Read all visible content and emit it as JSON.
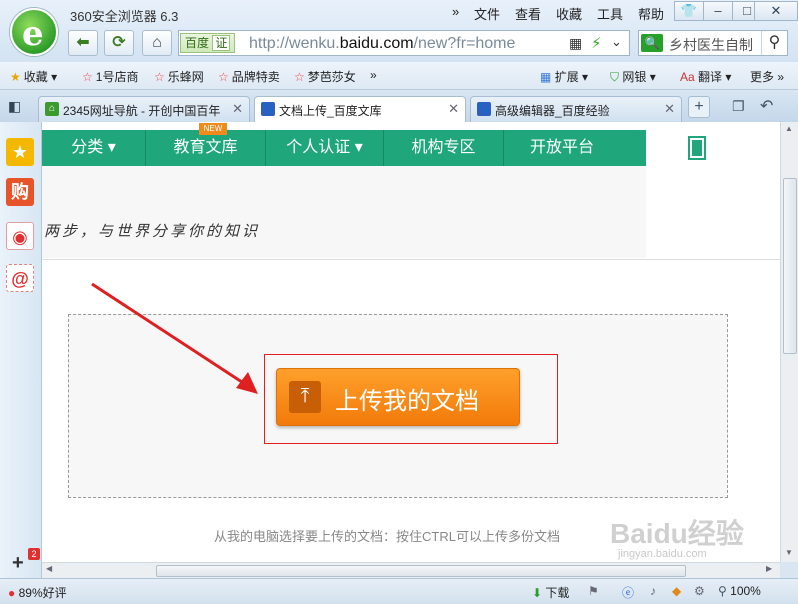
{
  "window": {
    "title": "360安全浏览器 6.3",
    "menu": [
      "文件",
      "查看",
      "收藏",
      "工具",
      "帮助"
    ],
    "chevron": "»"
  },
  "address": {
    "badge": "百度",
    "badge_tag": "证",
    "url_prefix": "http://wenku.",
    "url_domain": "baidu.com",
    "url_suffix": "/new?fr=home"
  },
  "search": {
    "query": "乡村医生自制"
  },
  "favorites": {
    "items": [
      "收藏",
      "1号店商",
      "乐蜂网",
      "品牌特卖",
      "梦芭莎女"
    ],
    "more_chevron": "»",
    "right": [
      "扩展",
      "网银",
      "翻译",
      "更多"
    ]
  },
  "tabs": [
    {
      "label": "2345网址导航 - 开创中国百年"
    },
    {
      "label": "文档上传_百度文库"
    },
    {
      "label": "高级编辑器_百度经验"
    }
  ],
  "sidebar": {
    "badge": "2"
  },
  "page": {
    "nav": [
      "分类",
      "教育文库",
      "个人认证",
      "机构专区",
      "开放平台"
    ],
    "new_badge": "NEW",
    "slogan": "两步，与世界分享你的知识",
    "upload_button": "上传我的文档",
    "hint": "从我的电脑选择要上传的文档：按住CTRL可以上传多份文档",
    "watermark": "Baidu经验",
    "watermark_sub": "jingyan.baidu.com"
  },
  "status": {
    "rating": "89%好评",
    "download": "下载",
    "zoom": "100%"
  },
  "colors": {
    "nav_green": "#1fa67a",
    "upload_orange": "#f27a0a",
    "highlight_red": "#e02020"
  }
}
